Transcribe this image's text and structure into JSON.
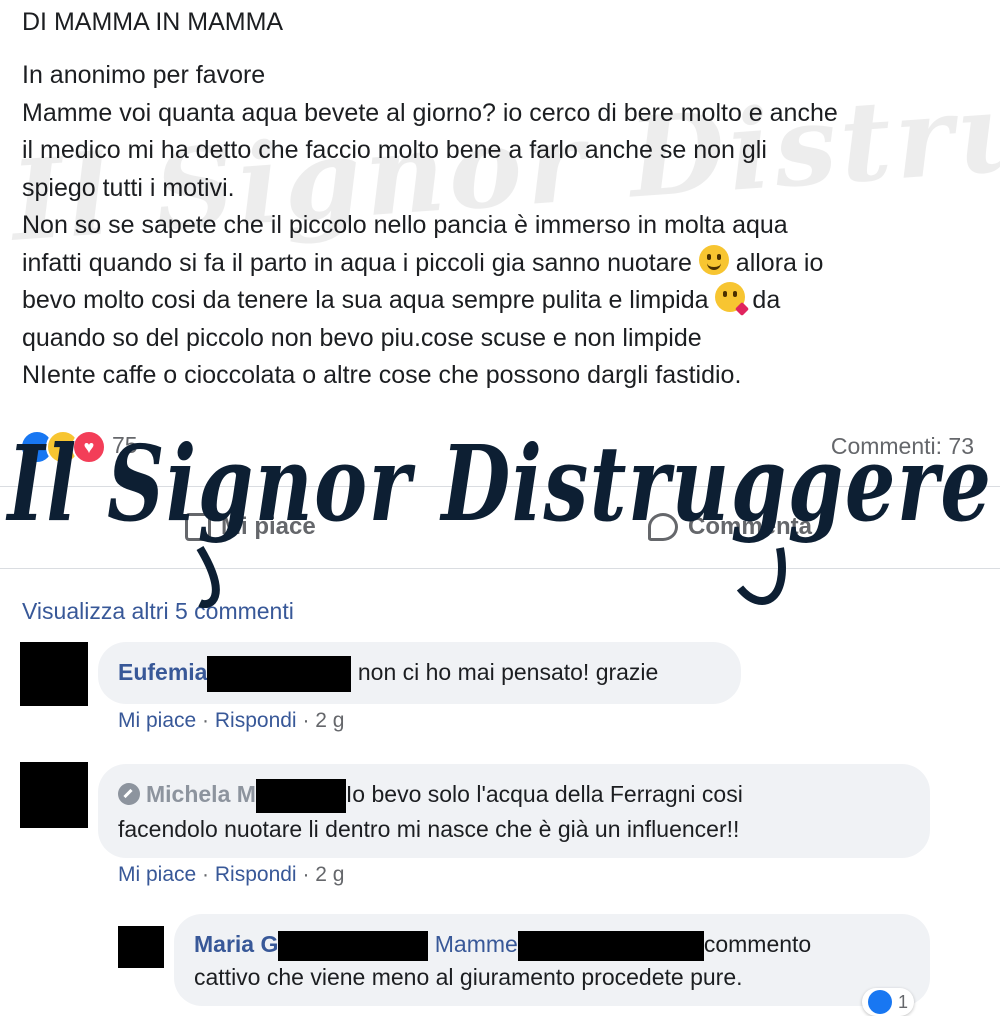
{
  "post": {
    "group_name": "DI MAMMA IN MAMMA",
    "lines": [
      "In anonimo per favore",
      "Mamme voi quanta aqua bevete al giorno? io cerco di bere molto e anche",
      "il medico mi ha detto che faccio molto bene a farlo anche se non gli",
      "spiego tutti i motivi.",
      "Non so se sapete che il piccolo nello pancia è immerso in molta aqua",
      "infatti quando si fa il parto in aqua i piccoli gia sanno nuotare",
      "allora io",
      "bevo molto cosi da tenere la sua aqua sempre pulita e limpida",
      "da",
      "quando so del piccolo non bevo piu.cose scuse e non limpide",
      "NIente caffe o cioccolata o altre cose che possono dargli fastidio."
    ],
    "emoji_1": "smile-emoji",
    "emoji_2": "kiss-emoji"
  },
  "reactions": {
    "icons": [
      "like-icon",
      "haha-icon",
      "love-icon"
    ],
    "count": "75",
    "comments_label": "Commenti: 73"
  },
  "actions": {
    "like_label": "Mi piace",
    "comment_label": "Commenta"
  },
  "comments_section": {
    "view_more": "Visualizza altri 5 commenti",
    "comments": [
      {
        "author": "Eufemia",
        "text": "non ci ho mai pensato! grazie",
        "like": "Mi piace",
        "reply": "Rispondi",
        "time": "2 g"
      },
      {
        "author": "Michela M",
        "text_line1": "Io bevo solo l'acqua della Ferragni cosi",
        "text_line2": "facendolo nuotare li dentro mi nasce che è già un influencer!!",
        "like": "Mi piace",
        "reply": "Rispondi",
        "time": "2 g"
      }
    ],
    "reply": {
      "author": "Maria G",
      "tag": "Mamme",
      "text_line1": "commento",
      "text_line2": "cattivo che viene meno al giuramento procedete pure.",
      "like_count": "1"
    }
  },
  "watermark": {
    "text": "Il Signor Distruggere"
  }
}
